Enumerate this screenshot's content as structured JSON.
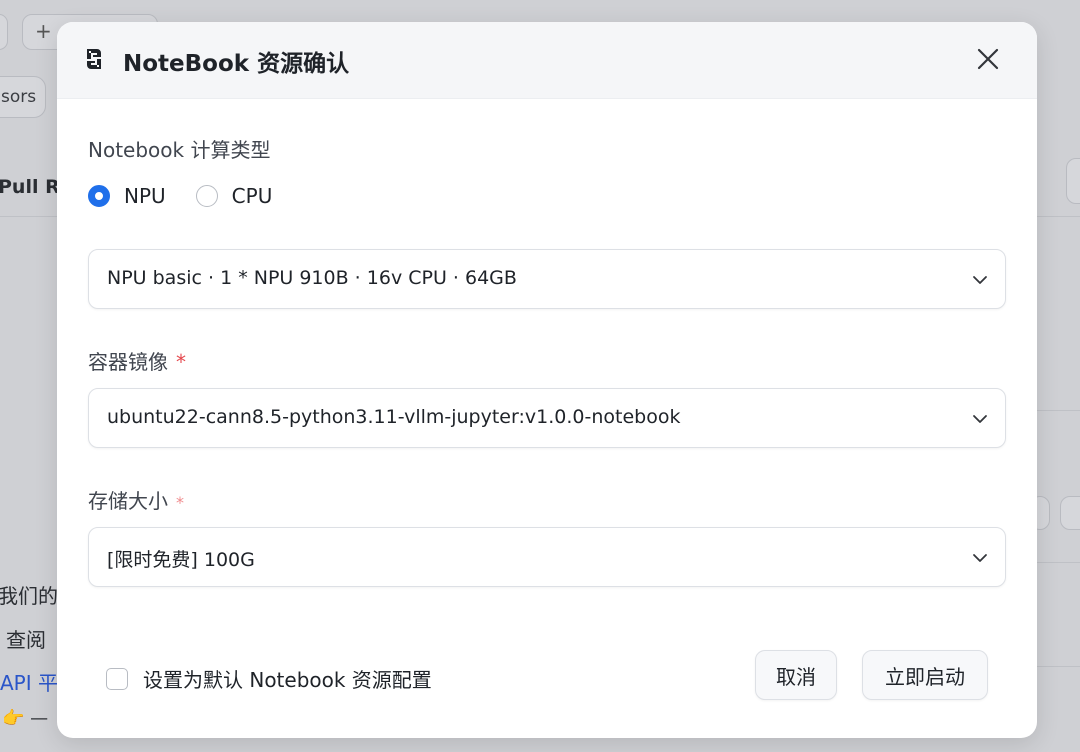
{
  "background": {
    "top_button_label": "+",
    "tag_text": "sors",
    "tab_text": "Pull Re",
    "line1": "我们的",
    "line2": "查阅",
    "line3": "API 平",
    "line4": "👉 —"
  },
  "dialog": {
    "title": "NoteBook 资源确认",
    "compute_type": {
      "label": "Notebook 计算类型",
      "options": [
        {
          "label": "NPU",
          "selected": true
        },
        {
          "label": "CPU",
          "selected": false
        }
      ]
    },
    "hardware_select": {
      "value": "NPU basic · 1 * NPU 910B · 16v CPU · 64GB"
    },
    "image_field": {
      "label": "容器镜像",
      "required_mark": "*",
      "value": "ubuntu22-cann8.5-python3.11-vllm-jupyter:v1.0.0-notebook"
    },
    "storage_field": {
      "label": "存储大小",
      "required_mark": "*",
      "value": "[限时免费] 100G"
    },
    "default_checkbox": {
      "label": "设置为默认 Notebook 资源配置",
      "checked": false
    },
    "cancel_label": "取消",
    "start_label": "立即启动"
  },
  "colors": {
    "accent": "#1f6fea",
    "required": "#e5484d",
    "overlay": "#cfd0d4"
  },
  "icons": {
    "logo": "python-logo-icon",
    "close": "close-icon",
    "dropdown": "chevron-down-icon"
  }
}
